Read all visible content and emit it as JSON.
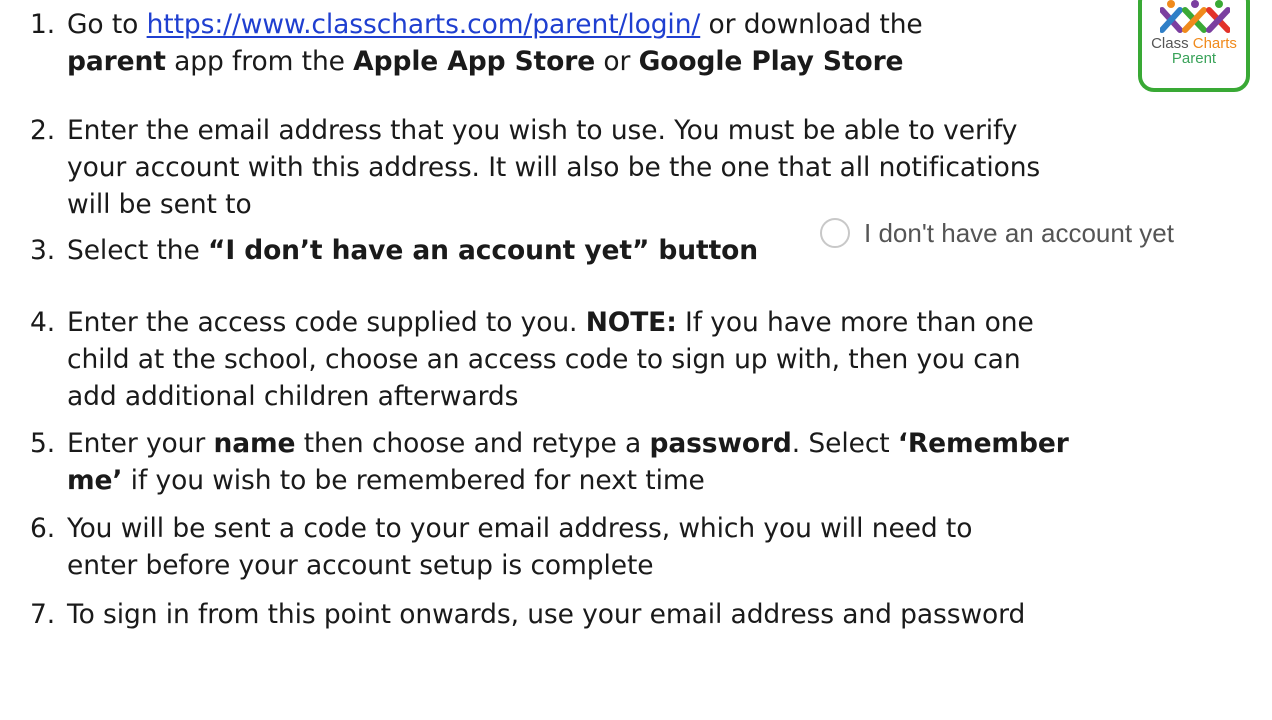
{
  "steps": [
    {
      "number": "1.",
      "lines": [
        {
          "a": "Go to ",
          "link": "https://www.classcharts.com/parent/login/",
          "b": " or download the"
        },
        {
          "b1": "parent",
          "t1": " app from the ",
          "b2": "Apple App Store",
          "t2": " or ",
          "b3": "Google Play Store"
        }
      ]
    },
    {
      "number": "2.",
      "lines": [
        "Enter the email address that you wish to use. You must be able to verify",
        "your account with this address. It will also be the one that all notifications",
        "will be sent to"
      ]
    },
    {
      "number": "3.",
      "text": "Select the ",
      "bold": "“I don’t have an account yet” button"
    },
    {
      "number": "4.",
      "line1_text": "Enter the access code supplied to you. ",
      "line1_bold": "NOTE:",
      "line1_tail": " If you have more than one",
      "line2": "child at the school, choose an access code to sign up with, then you can",
      "line3": "add additional children afterwards"
    },
    {
      "number": "5.",
      "t1": "Enter your ",
      "b1": "name",
      "t2": " then choose and retype a ",
      "b2": "password",
      "t3": ". Select ",
      "b3": "‘Remember",
      "b4": "me’",
      "t4": " if you wish to be remembered for next time"
    },
    {
      "number": "6.",
      "lines": [
        "You will be sent a code to your email address, which you will need to",
        "enter before your account setup is complete"
      ]
    },
    {
      "number": "7.",
      "lines": [
        "To sign in from this point onwards, use your email address and password"
      ]
    }
  ],
  "logo": {
    "brand_part1": "Class ",
    "brand_part2": "Charts",
    "brand_sub": "Parent",
    "icon": "people-figures-icon"
  },
  "radio_option": {
    "label": "I don't have an account yet"
  },
  "colors": {
    "link": "#1f3fd0",
    "logo_border": "#39a935",
    "brand_accent": "#f08a1c",
    "brand_sub": "#3aa35a"
  }
}
